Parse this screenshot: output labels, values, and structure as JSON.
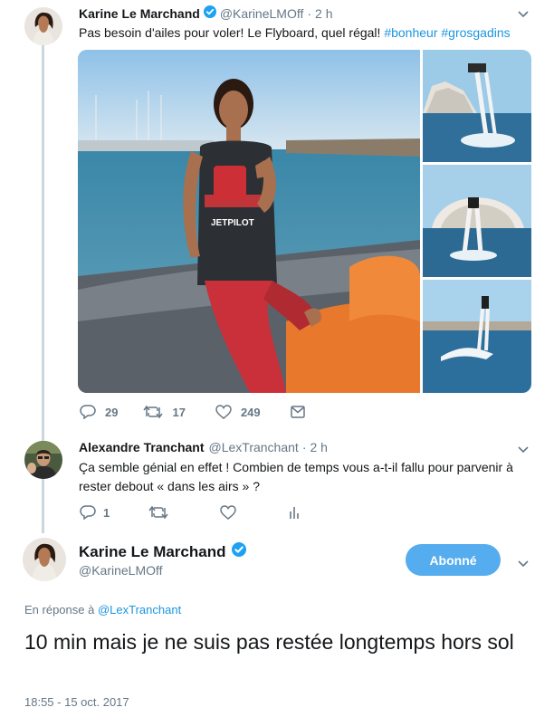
{
  "tweet1": {
    "name": "Karine Le Marchand",
    "handle": "@KarineLMOff",
    "separator": "·",
    "time": "2 h",
    "text_plain": "Pas besoin d'ailes pour voler!  Le Flyboard, quel régal! ",
    "hashtag1": "#bonheur",
    "hashtag2": "#grosgadins",
    "replies": "29",
    "retweets": "17",
    "likes": "249",
    "photo_logo_text": "JETPILOT"
  },
  "tweet2": {
    "name": "Alexandre Tranchant",
    "handle": "@LexTranchant",
    "separator": "·",
    "time": "2 h",
    "text": "Ça semble génial en effet ! Combien de temps vous a-t-il fallu pour parvenir à rester debout « dans les airs » ?",
    "replies": "1"
  },
  "main": {
    "name": "Karine Le Marchand",
    "handle": "@KarineLMOff",
    "follow_label": "Abonné",
    "reply_prefix": "En réponse à",
    "reply_handle": "@LexTranchant",
    "text": "10 min mais je ne suis pas restée longtemps hors sol",
    "timestamp": "18:55 - 15 oct. 2017"
  },
  "colors": {
    "accent": "#1b95e0",
    "follow_button": "#55acee",
    "verified": "#1da1f2",
    "muted": "#657786",
    "thread_line": "#ccd6dd"
  },
  "icons": [
    "verified-badge-icon",
    "chevron-down-icon",
    "reply-icon",
    "retweet-icon",
    "like-icon",
    "dm-icon",
    "analytics-icon"
  ]
}
